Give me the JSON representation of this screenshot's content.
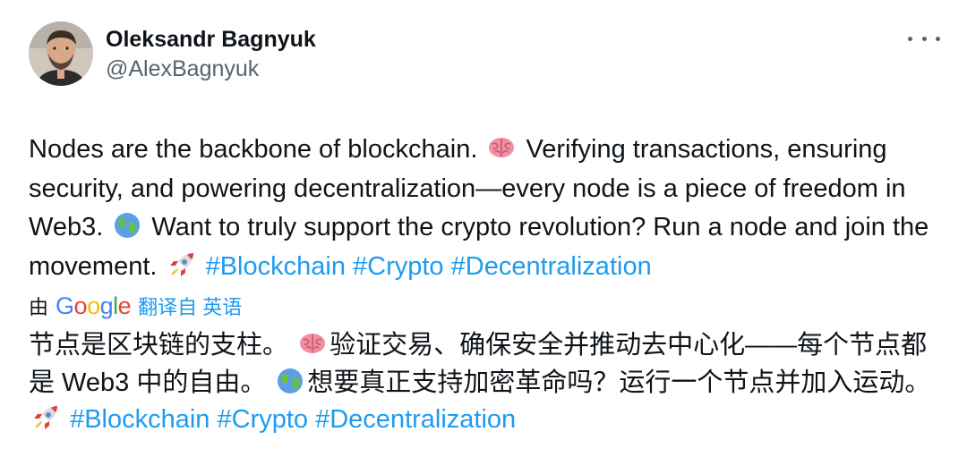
{
  "author": {
    "display_name": "Oleksandr Bagnyuk",
    "handle": "@AlexBagnyuk"
  },
  "more_button": {
    "icon": "more-horizontal-icon"
  },
  "tweet": {
    "line1_a": "Nodes are the backbone of blockchain.",
    "emoji_brain": "brain-emoji",
    "line1_b": "Verifying transactions, ensuring security, and powering decentralization—every node is a piece of freedom in Web3.",
    "emoji_globe": "globe-emoji",
    "line2": "Want to truly support the crypto revolution? Run a node and join the movement.",
    "emoji_rocket": "rocket-emoji",
    "hashtags": [
      "#Blockchain",
      "#Crypto",
      "#Decentralization"
    ]
  },
  "translation": {
    "by_label": "由",
    "provider": "Google",
    "translate_label": "翻译自 英语",
    "text_a": "节点是区块链的支柱。",
    "text_b": "验证交易、确保安全并推动去中心化——每个节点都是 Web3 中的自由。",
    "text_c": "想要真正支持加密革命吗？运行一个节点并加入运动。",
    "hashtags": [
      "#Blockchain",
      "#Crypto",
      "#Decentralization"
    ]
  },
  "colors": {
    "text": "#0f1419",
    "secondary": "#536471",
    "link": "#1d9bf0",
    "background": "#ffffff"
  }
}
